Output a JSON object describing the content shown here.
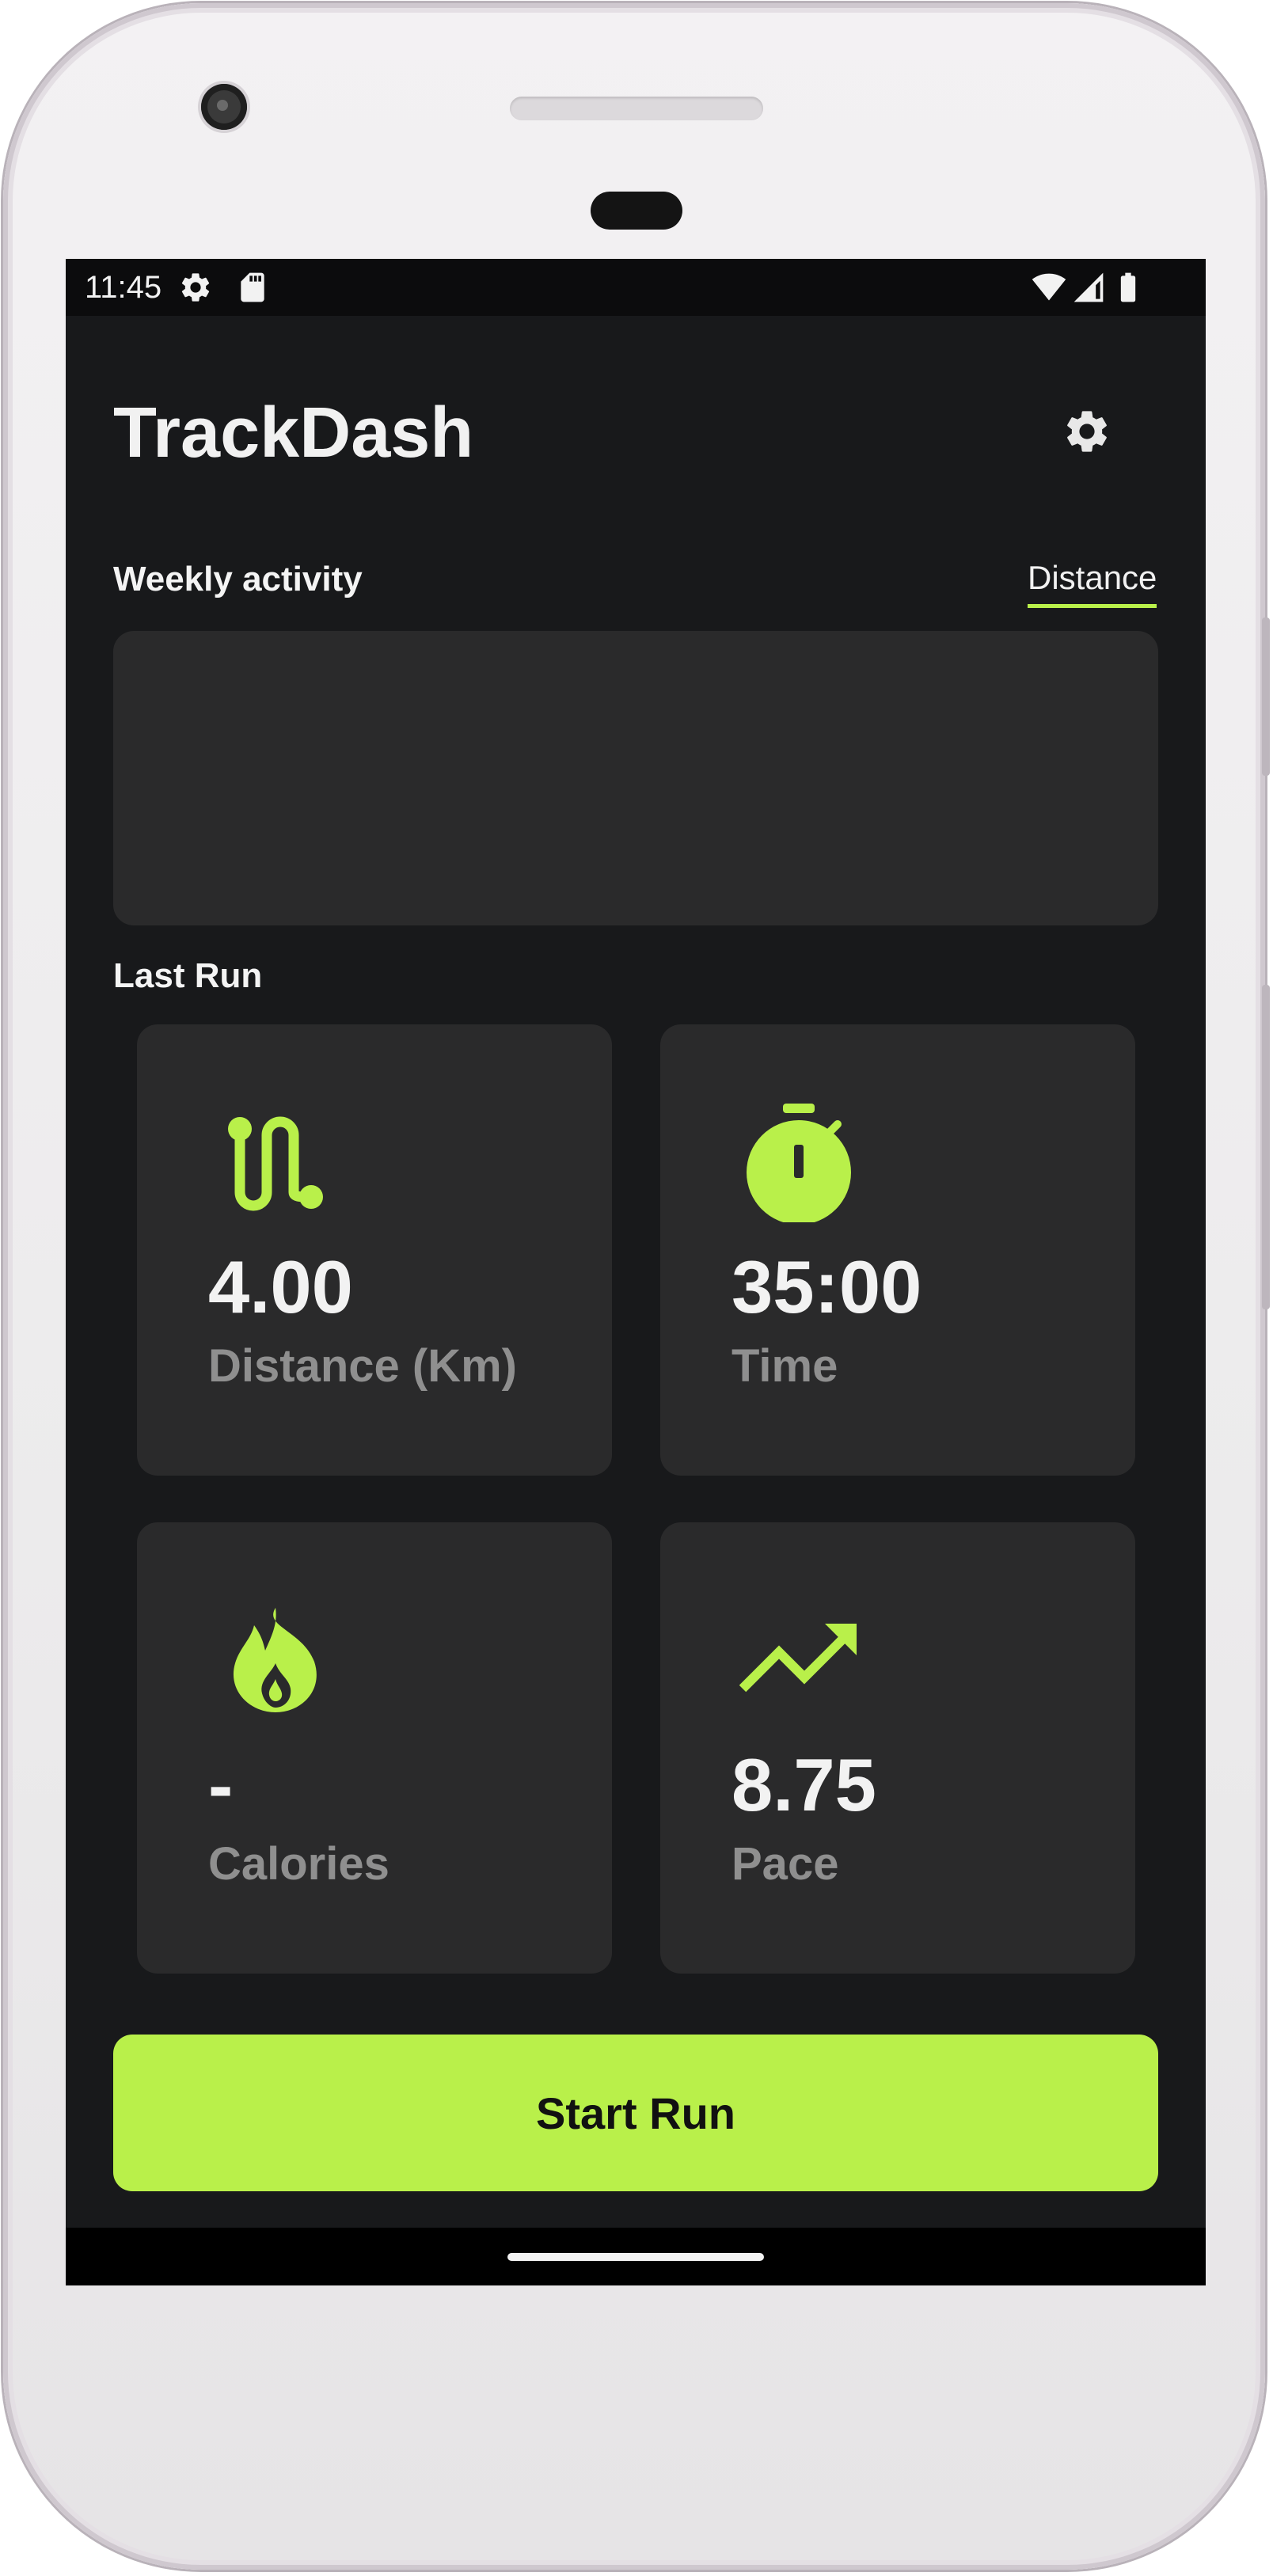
{
  "status_bar": {
    "time": "11:45",
    "icons": [
      "settings-gear-icon",
      "sd-card-icon",
      "wifi-icon",
      "signal-icon",
      "battery-icon"
    ]
  },
  "app": {
    "title": "TrackDash",
    "settings_icon": "gear-icon"
  },
  "weekly_activity": {
    "label": "Weekly activity",
    "selected_tab": "Distance"
  },
  "last_run": {
    "label": "Last Run",
    "stats": [
      {
        "icon": "route-icon",
        "value": "4.00",
        "label": "Distance (Km)"
      },
      {
        "icon": "stopwatch-icon",
        "value": "35:00",
        "label": "Time"
      },
      {
        "icon": "flame-icon",
        "value": "-",
        "label": "Calories"
      },
      {
        "icon": "trend-icon",
        "value": "8.75",
        "label": "Pace"
      }
    ]
  },
  "actions": {
    "start_run_label": "Start Run"
  },
  "colors": {
    "accent": "#b9f04a",
    "background": "#18191b",
    "card": "#2a2a2b",
    "muted_text": "#8f8f8f"
  }
}
